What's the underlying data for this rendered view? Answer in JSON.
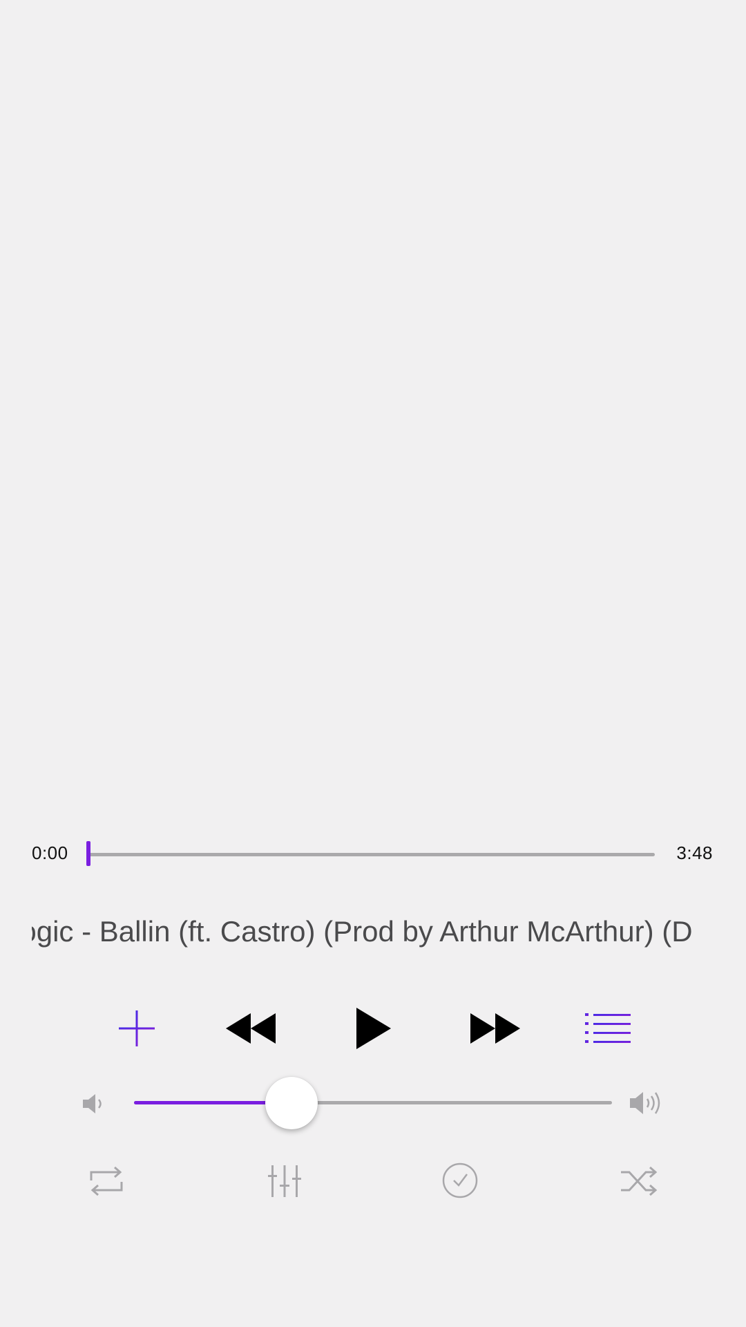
{
  "player": {
    "elapsed": "0:00",
    "duration": "3:48",
    "progress_fraction": 0.0,
    "title": "Logic - Ballin (ft. Castro) (Prod by Arthur McArthur) (D",
    "volume_fraction": 0.33
  },
  "icons": {
    "add": "plus-icon",
    "rewind": "rewind-icon",
    "play": "play-icon",
    "fast_forward": "fast-forward-icon",
    "queue": "list-icon",
    "volume_low": "speaker-low-icon",
    "volume_high": "speaker-high-icon",
    "repeat": "repeat-icon",
    "equalizer": "equalizer-icon",
    "timer": "checkmark-circle-icon",
    "shuffle": "shuffle-icon"
  },
  "colors": {
    "accent": "#7a1ee0",
    "background": "#f1f0f1",
    "track": "#aaa9ab",
    "inactive_icon": "#a8a7aa"
  }
}
